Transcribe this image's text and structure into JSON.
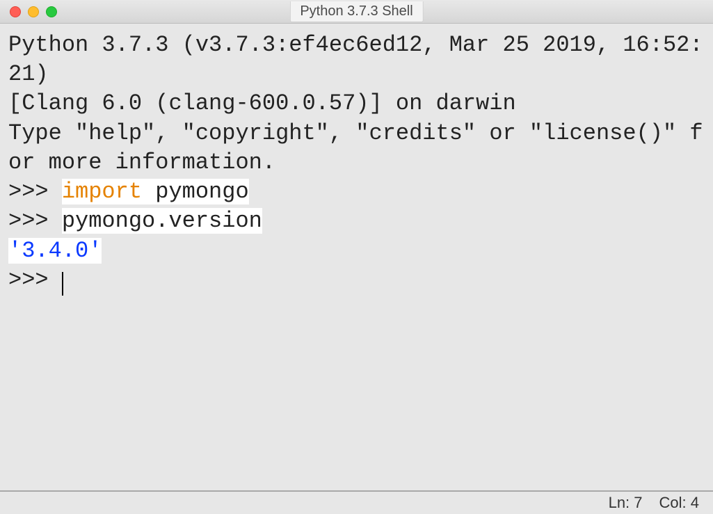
{
  "window": {
    "title": "Python 3.7.3 Shell"
  },
  "shell": {
    "banner_line1": "Python 3.7.3 (v3.7.3:ef4ec6ed12, Mar 25 2019, 16:52:21) ",
    "banner_line2": "[Clang 6.0 (clang-600.0.57)] on darwin",
    "banner_line3": "Type \"help\", \"copyright\", \"credits\" or \"license()\" for more information.",
    "prompt": ">>> ",
    "input1_kw": "import",
    "input1_rest": " pymongo",
    "input2": "pymongo.version",
    "output1": "'3.4.0'"
  },
  "status": {
    "line_label": "Ln: 7",
    "col_label": "Col: 4"
  }
}
